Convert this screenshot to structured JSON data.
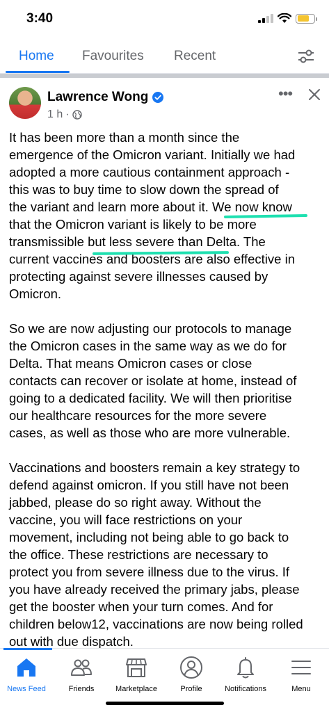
{
  "status_bar": {
    "time": "3:40"
  },
  "tabs": [
    {
      "label": "Home",
      "active": true
    },
    {
      "label": "Favourites",
      "active": false
    },
    {
      "label": "Recent",
      "active": false
    }
  ],
  "post": {
    "author": "Lawrence Wong",
    "time_ago": "1 h",
    "separator": "·",
    "paragraphs": [
      [
        "It has been more than a month since the",
        "emergence of the Omicron variant. Initially we had",
        "adopted a more cautious containment approach -",
        "this was to buy time to slow down the spread of",
        "the variant and learn more about it. We now know",
        "that the Omicron variant is likely to be more",
        "transmissible but less severe than Delta. The",
        "current vaccines and boosters are also effective in",
        "protecting against severe illnesses caused by",
        "Omicron."
      ],
      [
        "So we are now adjusting our protocols to manage",
        "the Omicron cases in the same way as we do for",
        "Delta. That means Omicron cases or close",
        "contacts can recover or isolate at home, instead of",
        "going to a dedicated facility. We will then prioritise",
        "our healthcare resources for the more severe",
        "cases, as well as those who are more vulnerable."
      ],
      [
        "Vaccinations and boosters remain a key strategy to",
        "defend against omicron. If you still have not been",
        "jabbed, please do so right away. Without the",
        "vaccine, you will face restrictions on your",
        "movement, including not being able to go back to",
        "the office. These restrictions are necessary to",
        "protect you from severe illness due to the virus. If",
        "you have already received the primary jabs, please",
        "get the booster when your turn comes. And for",
        "children below12, vaccinations are now being rolled",
        "out with due dispatch."
      ]
    ]
  },
  "bottom_nav": [
    {
      "label": "News Feed",
      "icon": "home-icon",
      "active": true
    },
    {
      "label": "Friends",
      "icon": "friends-icon",
      "active": false
    },
    {
      "label": "Marketplace",
      "icon": "marketplace-icon",
      "active": false
    },
    {
      "label": "Profile",
      "icon": "profile-icon",
      "active": false
    },
    {
      "label": "Notifications",
      "icon": "bell-icon",
      "active": false
    },
    {
      "label": "Menu",
      "icon": "menu-icon",
      "active": false
    }
  ],
  "colors": {
    "accent": "#1877f2",
    "highlight": "#1ee0b0",
    "secondary_text": "#65676b"
  }
}
